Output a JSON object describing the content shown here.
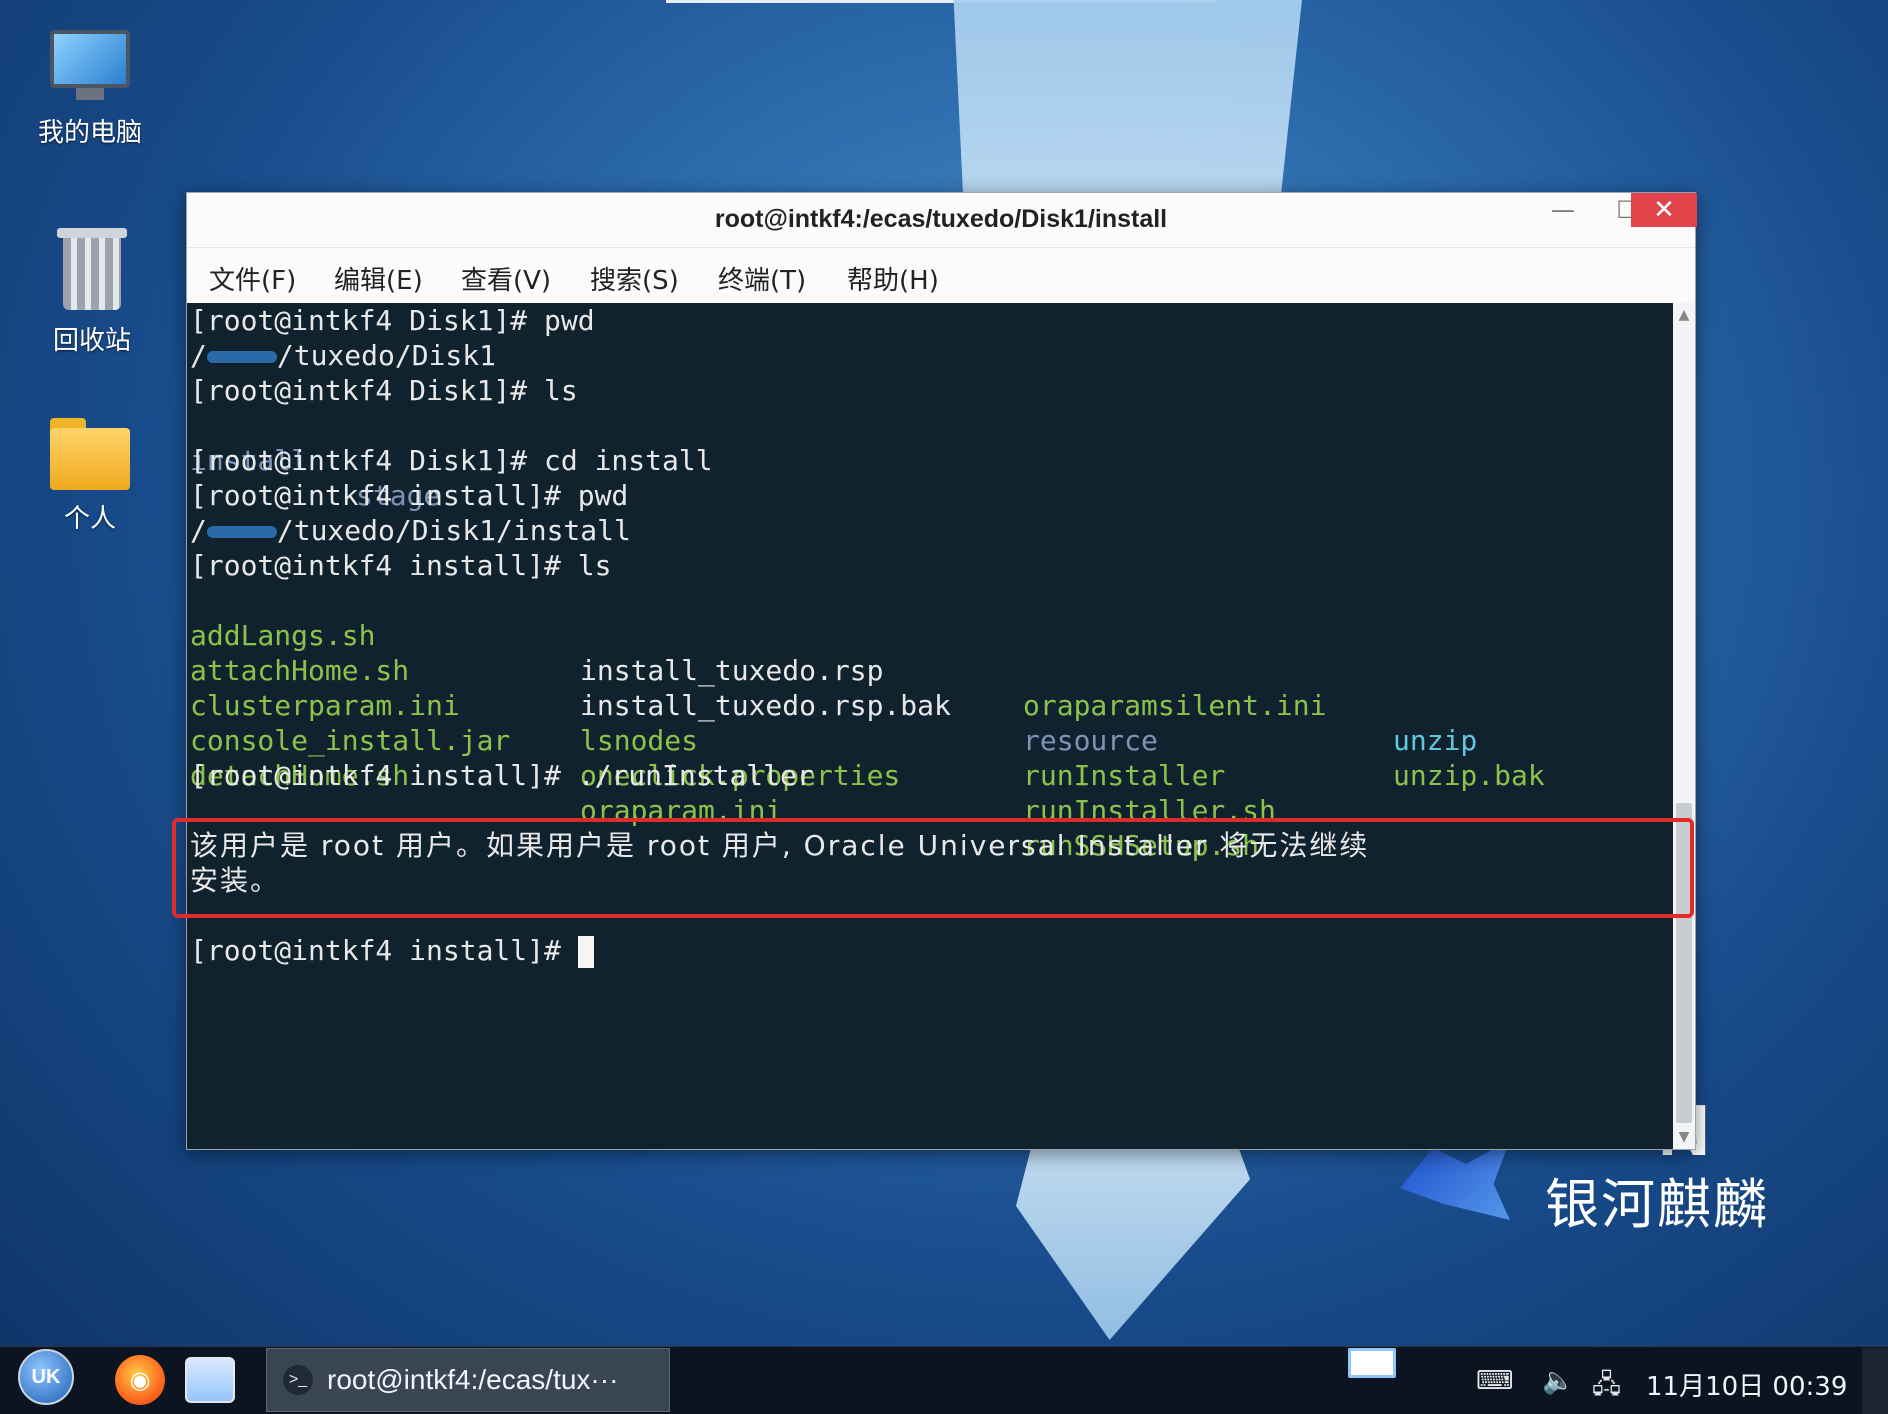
{
  "desktop": {
    "icons": [
      {
        "label": "我的电脑"
      },
      {
        "label": "回收站"
      },
      {
        "label": "个人"
      }
    ],
    "brand_text": "银河麒麟",
    "brand_partial": "N"
  },
  "window": {
    "title": "root@intkf4:/ecas/tuxedo/Disk1/install",
    "buttons": {
      "minimize": "—",
      "maximize": "☐",
      "close": "✕"
    },
    "menu": [
      "文件(F)",
      "编辑(E)",
      "查看(V)",
      "搜索(S)",
      "终端(T)",
      "帮助(H)"
    ]
  },
  "terminal": {
    "lines": [
      "[root@intkf4 Disk1]# pwd",
      "/tuxedo/Disk1",
      "[root@intkf4 Disk1]# ls",
      "",
      "[root@intkf4 Disk1]# cd install",
      "[root@intkf4 install]# pwd",
      "/tuxedo/Disk1/install",
      "[root@intkf4 install]# ls"
    ],
    "ls_disk1": [
      "install",
      "stage"
    ],
    "ls_install": {
      "col1": [
        "addLangs.sh",
        "attachHome.sh",
        "clusterparam.ini",
        "console_install.jar",
        "detachHome.sh"
      ],
      "col2": [
        "install_tuxedo.rsp",
        "install_tuxedo.rsp.bak",
        "lsnodes",
        "oneclick.properties",
        "oraparam.ini"
      ],
      "col3": [
        "oraparamsilent.ini",
        "resource",
        "runInstaller",
        "runInstaller.sh",
        "runSSHSetup.sh"
      ],
      "col4": [
        "unzip",
        "unzip.bak"
      ]
    },
    "run_cmd": "[root@intkf4 install]# ./runInstaller",
    "error_line1": "该用户是 root 用户。如果用户是 root 用户, Oracle Universal Installer 将无法继续",
    "error_line2": "安装。",
    "final_prompt": "[root@intkf4 install]# "
  },
  "taskbar": {
    "start_label": "UK",
    "task_title": "root@intkf4:/ecas/tux···",
    "clock": "11月10日 00:39"
  },
  "colors": {
    "terminal_bg": "#11222f",
    "executable_green": "#8bc34a",
    "directory_blue": "#7e94b6",
    "highlight_red": "#e02b2b",
    "close_red": "#e0434a"
  }
}
